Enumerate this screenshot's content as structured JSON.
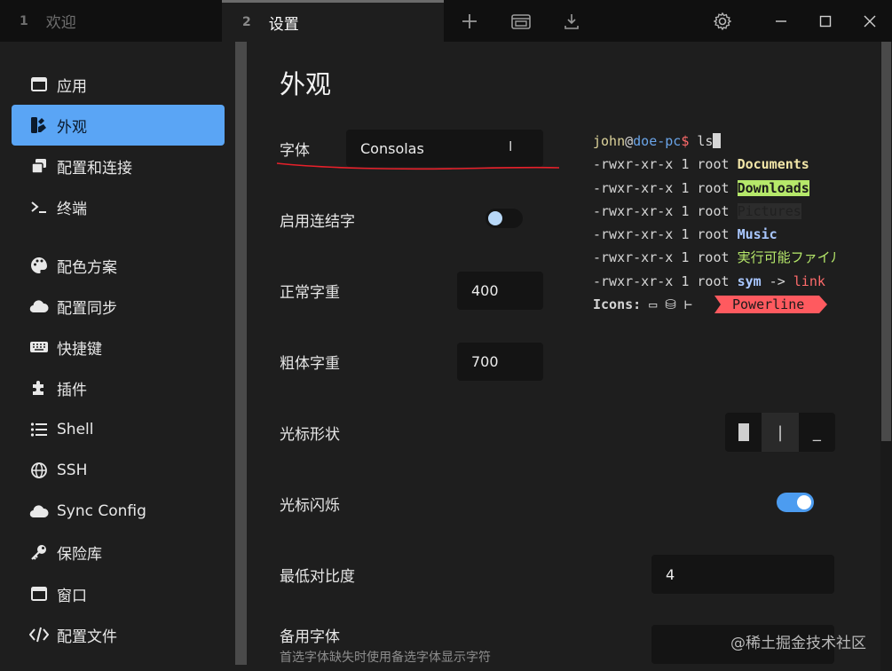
{
  "tabs": [
    {
      "num": "1",
      "label": "欢迎"
    },
    {
      "num": "2",
      "label": "设置"
    }
  ],
  "toolbar": {
    "icons": [
      "plus-icon",
      "window-icon",
      "download-icon",
      "gear-icon",
      "minimize-icon",
      "maximize-icon",
      "close-icon"
    ]
  },
  "sidebar": {
    "items": [
      {
        "label": "应用",
        "icon": "window-icon"
      },
      {
        "label": "外观",
        "icon": "palette-brush-icon",
        "active": true
      },
      {
        "label": "配置和连接",
        "icon": "windows-stack-icon"
      },
      {
        "label": "终端",
        "icon": "terminal-icon"
      },
      {
        "label": "配色方案",
        "icon": "palette-icon"
      },
      {
        "label": "配置同步",
        "icon": "cloud-icon"
      },
      {
        "label": "快捷键",
        "icon": "keyboard-icon"
      },
      {
        "label": "插件",
        "icon": "puzzle-icon"
      },
      {
        "label": "Shell",
        "icon": "list-icon"
      },
      {
        "label": "SSH",
        "icon": "globe-icon"
      },
      {
        "label": "Sync Config",
        "icon": "cloud-icon"
      },
      {
        "label": "保险库",
        "icon": "key-icon"
      },
      {
        "label": "窗口",
        "icon": "window-icon"
      },
      {
        "label": "配置文件",
        "icon": "code-icon"
      }
    ]
  },
  "main": {
    "title": "外观",
    "font": {
      "label": "字体",
      "value": "Consolas",
      "caret": "I"
    },
    "ligatures": {
      "label": "启用连结字",
      "enabled": false
    },
    "normal_weight": {
      "label": "正常字重",
      "value": "400"
    },
    "bold_weight": {
      "label": "粗体字重",
      "value": "700"
    },
    "cursor_shape": {
      "label": "光标形状",
      "options": [
        "block",
        "beam",
        "underline"
      ],
      "selected": "beam",
      "beam_glyph": "|",
      "underline_glyph": "_"
    },
    "cursor_blink": {
      "label": "光标闪烁",
      "enabled": true
    },
    "min_contrast": {
      "label": "最低对比度",
      "value": "4"
    },
    "fallback_font": {
      "label": "备用字体",
      "description": "首选字体缺失时使用备选字体显示字符"
    }
  },
  "preview": {
    "prompt_user": "john",
    "prompt_at": "@",
    "prompt_host": "doe-pc",
    "prompt_dollar": "$",
    "command": " ls",
    "perm": "-rwxr-xr-x 1 root ",
    "files": [
      "Documents",
      "Downloads",
      "Pictures",
      "Music",
      "実行可能ファイル",
      "sym"
    ],
    "arrow": " -> ",
    "link": "link",
    "icons_label": "Icons: ",
    "icons_glyphs": "▭ ⛁ ⊢ ",
    "powerline": "Powerline"
  },
  "watermark": "@稀土掘金技术社区",
  "colors": {
    "accent": "#5aa5f5",
    "toggle_on": "#4c9cf0",
    "annotation_red": "#e8202a"
  }
}
